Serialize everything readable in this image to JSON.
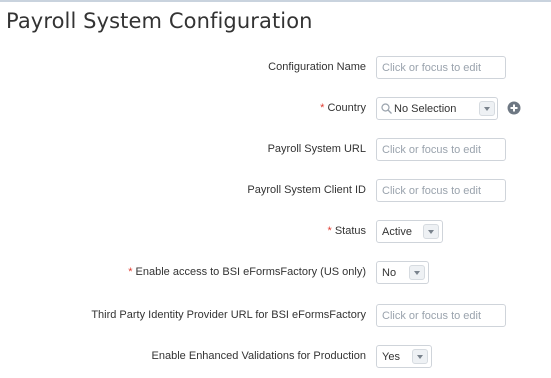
{
  "page": {
    "title": "Payroll System Configuration"
  },
  "form": {
    "placeholder": "Click or focus to edit",
    "fields": {
      "config_name": {
        "label": "Configuration Name"
      },
      "country": {
        "required_mark": "*",
        "label": "Country",
        "value": "No Selection"
      },
      "payroll_url": {
        "label": "Payroll System URL"
      },
      "client_id": {
        "label": "Payroll System Client ID"
      },
      "status": {
        "required_mark": "*",
        "label": "Status",
        "value": "Active"
      },
      "bsi_access": {
        "required_mark": "*",
        "label": "Enable access to BSI eFormsFactory (US only)",
        "value": "No"
      },
      "idp_url": {
        "label": "Third Party Identity Provider URL for BSI eFormsFactory"
      },
      "enhanced_validations": {
        "label": "Enable Enhanced Validations for Production",
        "value": "Yes"
      }
    }
  },
  "icons": {
    "search": "search-icon",
    "add": "plus-circle-icon",
    "dropdown": "chevron-down-icon"
  },
  "colors": {
    "required": "#e03c31",
    "input_border": "#cfd4da",
    "placeholder": "#9aa3ad",
    "add_icon": "#6e7883"
  }
}
